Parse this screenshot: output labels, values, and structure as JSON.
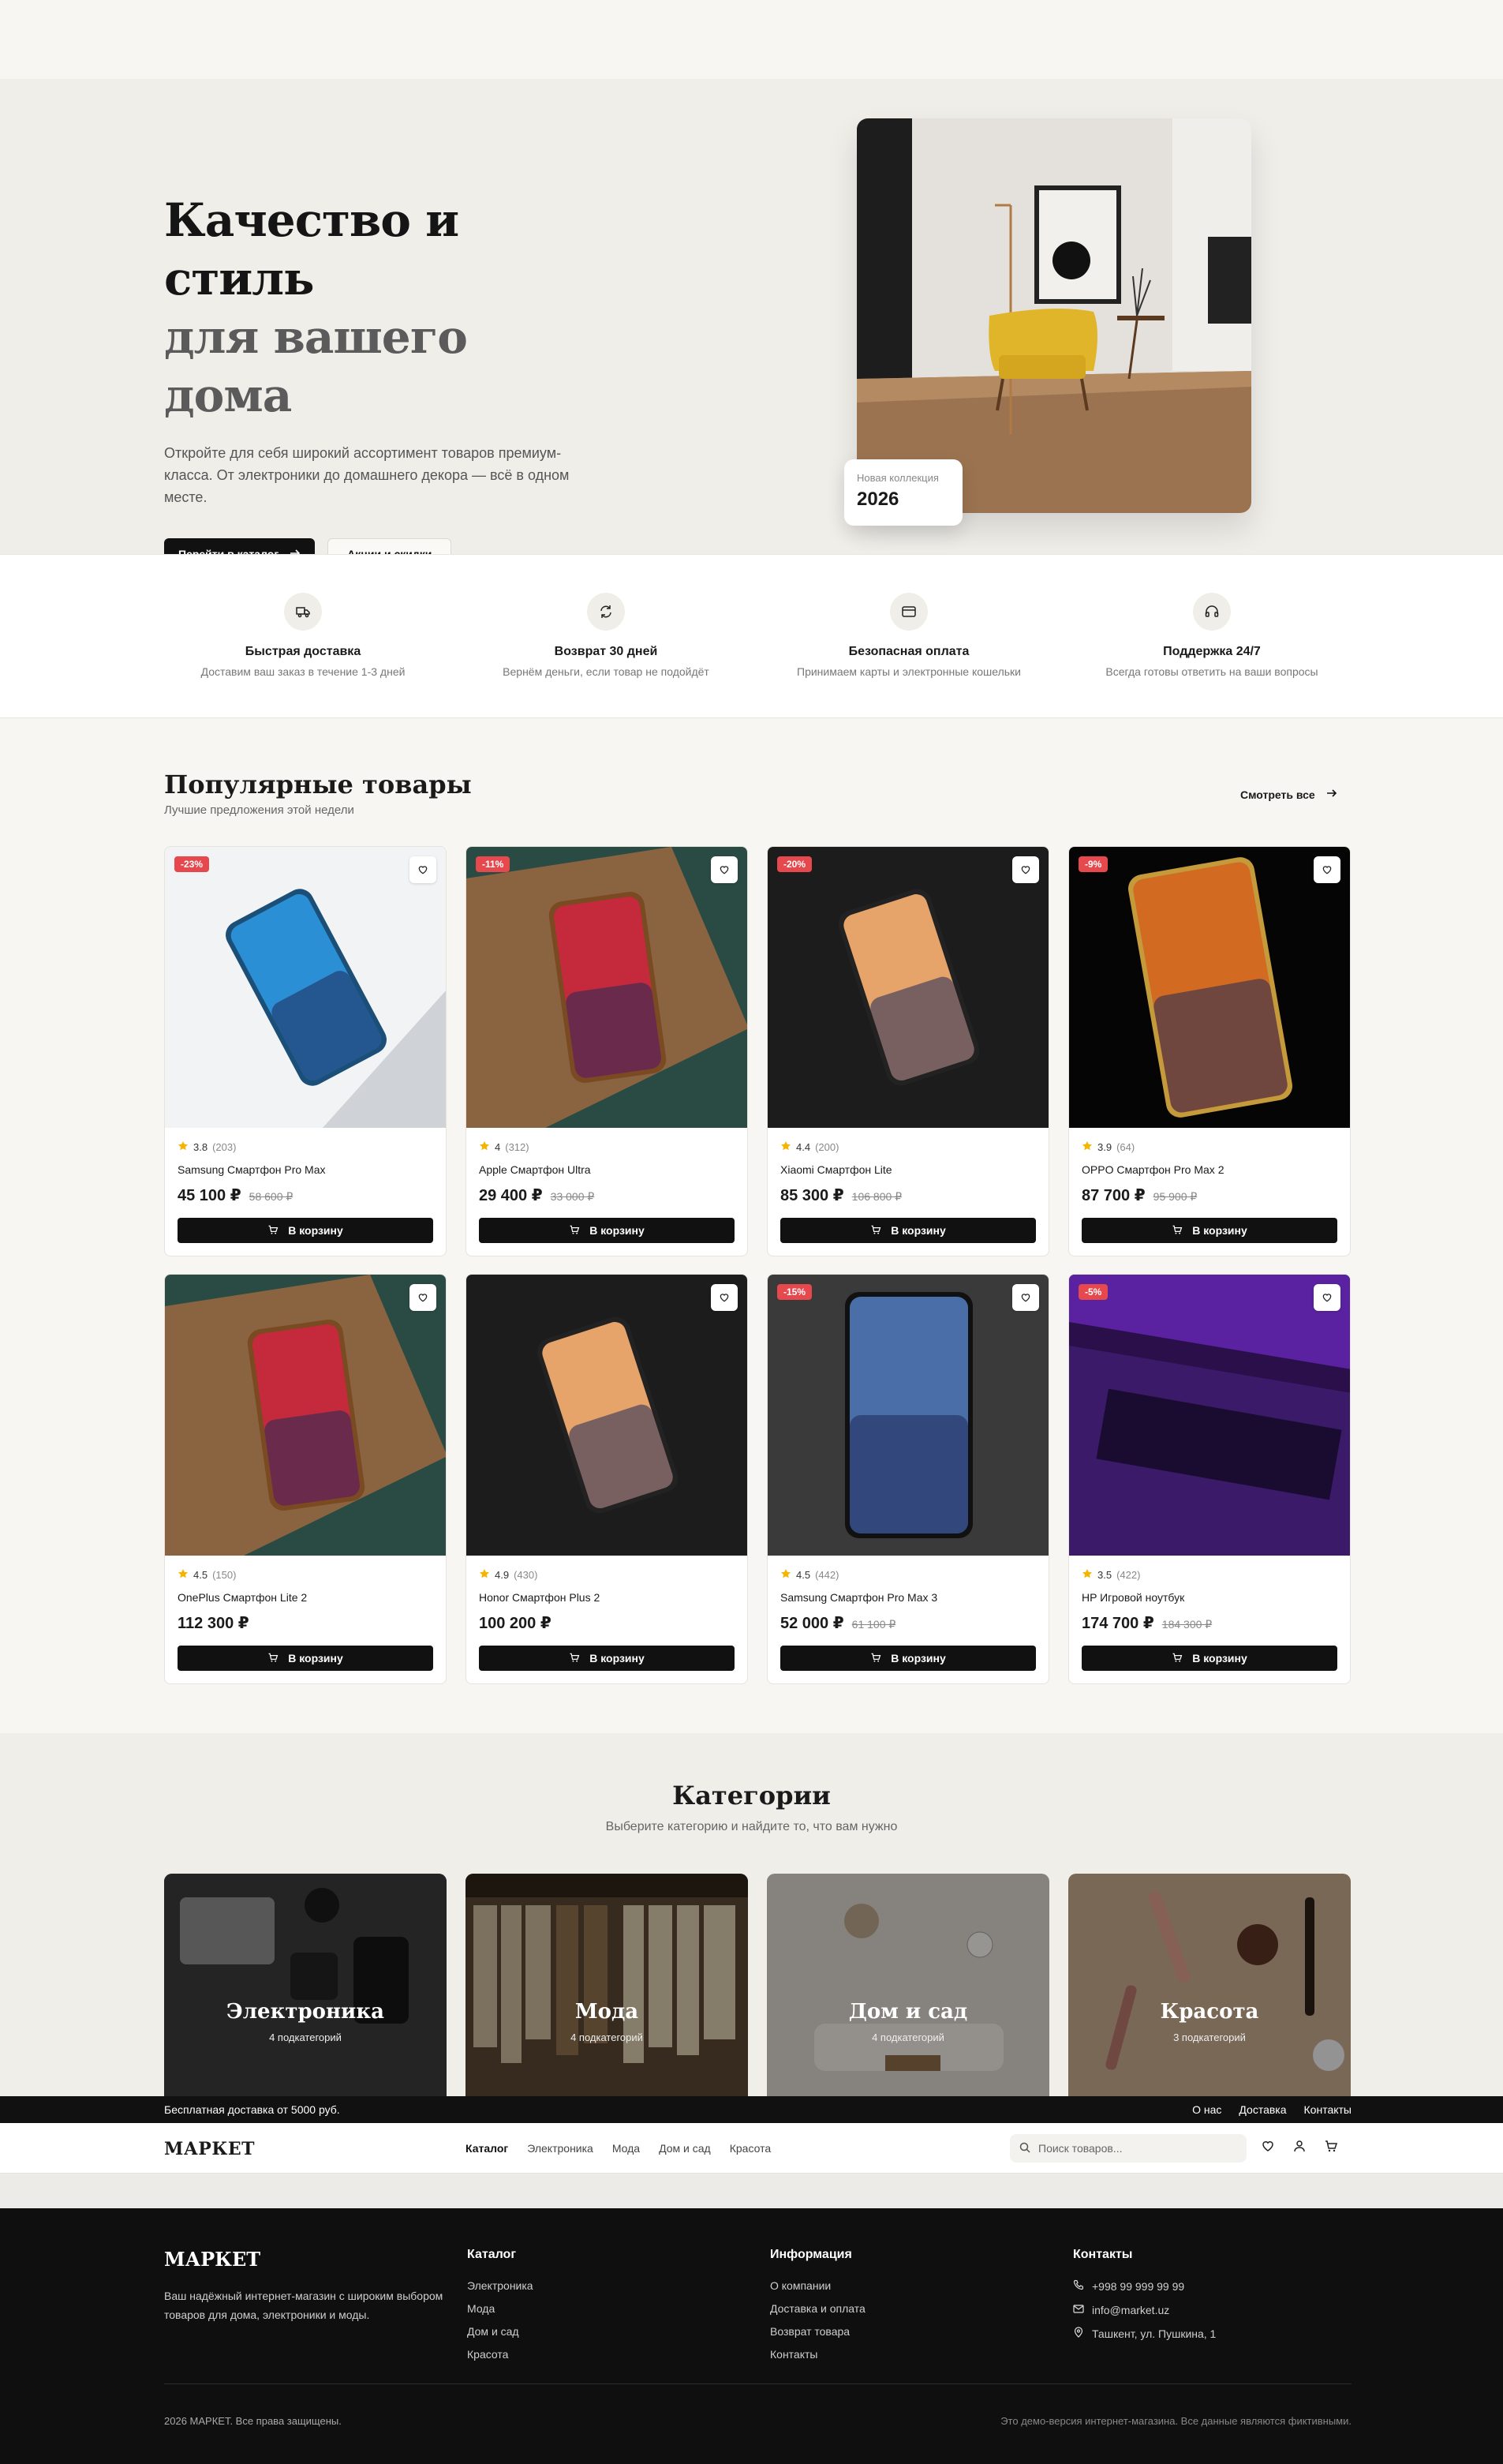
{
  "hero": {
    "title_line1": "Качество и стиль",
    "title_line2": "для вашего дома",
    "description": "Откройте для себя широкий ассортимент товаров премиум-класса. От электроники до домашнего декора — всё в одном месте.",
    "btn_catalog": "Перейти в каталог",
    "btn_sales": "Акции и скидки",
    "badge_label": "Новая коллекция",
    "badge_value": "2026"
  },
  "features": [
    {
      "icon": "truck-icon",
      "title": "Быстрая доставка",
      "desc": "Доставим ваш заказ в течение 1-3 дней"
    },
    {
      "icon": "refresh-icon",
      "title": "Возврат 30 дней",
      "desc": "Вернём деньги, если товар не подойдёт"
    },
    {
      "icon": "card-icon",
      "title": "Безопасная оплата",
      "desc": "Принимаем карты и электронные кошельки"
    },
    {
      "icon": "headphones-icon",
      "title": "Поддержка 24/7",
      "desc": "Всегда готовы ответить на ваши вопросы"
    }
  ],
  "popular": {
    "title": "Популярные товары",
    "subtitle": "Лучшие предложения этой недели",
    "see_all": "Смотреть все",
    "cart_label": "В корзину",
    "products": [
      {
        "discount": "-23%",
        "rating": "3.8",
        "count": "(203)",
        "name": "Samsung Смартфон Pro Max",
        "price": "45 100 ₽",
        "old": "58 600 ₽"
      },
      {
        "discount": "-11%",
        "rating": "4",
        "count": "(312)",
        "name": "Apple Смартфон Ultra",
        "price": "29 400 ₽",
        "old": "33 000 ₽"
      },
      {
        "discount": "-20%",
        "rating": "4.4",
        "count": "(200)",
        "name": "Xiaomi Смартфон Lite",
        "price": "85 300 ₽",
        "old": "106 800 ₽"
      },
      {
        "discount": "-9%",
        "rating": "3.9",
        "count": "(64)",
        "name": "OPPO Смартфон Pro Max 2",
        "price": "87 700 ₽",
        "old": "95 900 ₽"
      },
      {
        "discount": "",
        "rating": "4.5",
        "count": "(150)",
        "name": "OnePlus Смартфон Lite 2",
        "price": "112 300 ₽",
        "old": ""
      },
      {
        "discount": "",
        "rating": "4.9",
        "count": "(430)",
        "name": "Honor Смартфон Plus 2",
        "price": "100 200 ₽",
        "old": ""
      },
      {
        "discount": "-15%",
        "rating": "4.5",
        "count": "(442)",
        "name": "Samsung Смартфон Pro Max 3",
        "price": "52 000 ₽",
        "old": "61 100 ₽"
      },
      {
        "discount": "-5%",
        "rating": "3.5",
        "count": "(422)",
        "name": "HP Игровой ноутбук",
        "price": "174 700 ₽",
        "old": "184 300 ₽"
      }
    ]
  },
  "categories": {
    "title": "Категории",
    "subtitle": "Выберите категорию и найдите то, что вам нужно",
    "items": [
      {
        "name": "Электроника",
        "count": "4 подкатегорий"
      },
      {
        "name": "Мода",
        "count": "4 подкатегорий"
      },
      {
        "name": "Дом и сад",
        "count": "4 подкатегорий"
      },
      {
        "name": "Красота",
        "count": "3 подкатегорий"
      }
    ]
  },
  "promo": {
    "text": "Бесплатная доставка от 5000 руб.",
    "links": [
      "О нас",
      "Доставка",
      "Контакты"
    ]
  },
  "nav": {
    "logo": "МАРКЕТ",
    "links": [
      "Каталог",
      "Электроника",
      "Мода",
      "Дом и сад",
      "Красота"
    ],
    "search_placeholder": "Поиск товаров..."
  },
  "footer": {
    "logo": "МАРКЕТ",
    "description": "Ваш надёжный интернет-магазин с широким выбором товаров для дома, электроники и моды.",
    "catalog_title": "Каталог",
    "catalog_links": [
      "Электроника",
      "Мода",
      "Дом и сад",
      "Красота"
    ],
    "info_title": "Информация",
    "info_links": [
      "О компании",
      "Доставка и оплата",
      "Возврат товара",
      "Контакты"
    ],
    "contacts_title": "Контакты",
    "phone": "+998 99 999 99 99",
    "email": "info@market.uz",
    "address": "Ташкент, ул. Пушкина, 1",
    "copyright": "2026 МАРКЕТ. Все права защищены.",
    "demo_note": "Это демо-версия интернет-магазина. Все данные являются фиктивными."
  },
  "colors": {
    "accent": "#111111",
    "discount": "#e5484d",
    "star": "#f5b400",
    "bg": "#f0eee9"
  }
}
